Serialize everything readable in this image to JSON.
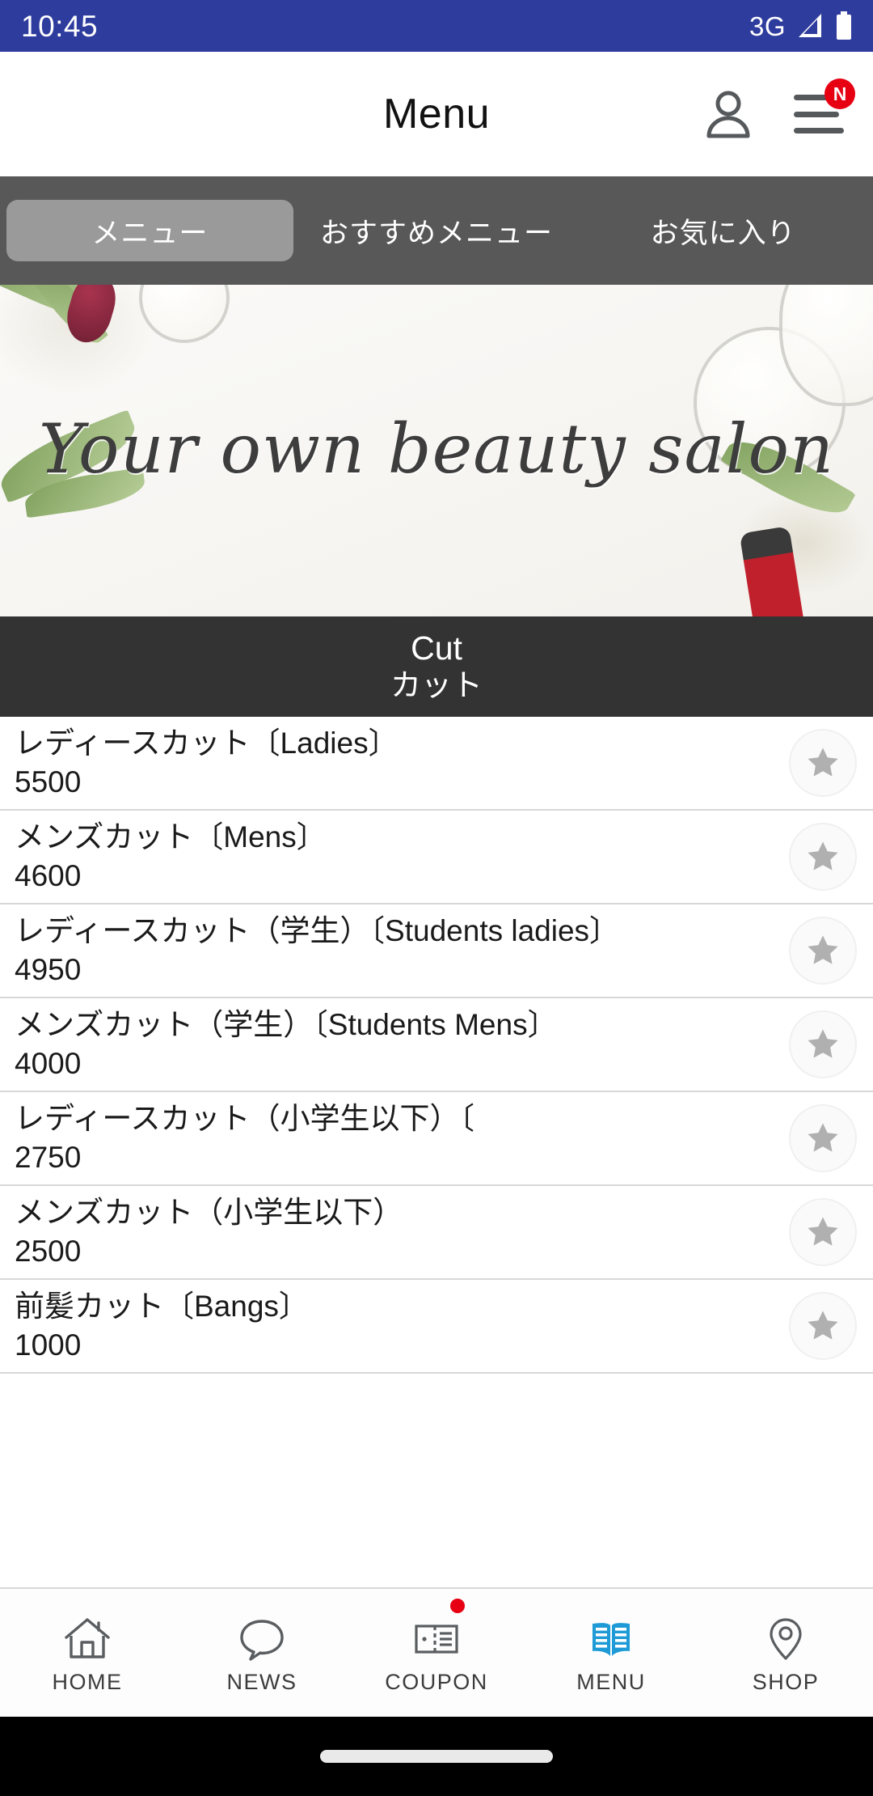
{
  "status_bar": {
    "time": "10:45",
    "network": "3G",
    "signal_icon": "signal-triangle-icon",
    "battery_icon": "battery-full-icon",
    "background_color": "#2e3c9e"
  },
  "header": {
    "title": "Menu",
    "account_icon": "person-icon",
    "menu_icon": "hamburger-menu-icon",
    "badge_label": "N",
    "badge_color": "#e60012"
  },
  "tabs": [
    {
      "label": "メニュー",
      "active": true
    },
    {
      "label": "おすすめメニュー",
      "active": false
    },
    {
      "label": "お気に入り",
      "active": false
    }
  ],
  "banner": {
    "headline": "Your own beauty salon",
    "alt": "beauty salon flat-lay with olive branches, cream jars and nail polish"
  },
  "section": {
    "title_en": "Cut",
    "title_jp": "カット",
    "background_color": "#333333"
  },
  "menu_items": [
    {
      "name": "レディースカット〔Ladies〕",
      "price": "5500",
      "favorite_icon": "star-icon"
    },
    {
      "name": "メンズカット〔Mens〕",
      "price": "4600",
      "favorite_icon": "star-icon"
    },
    {
      "name": "レディースカット（学生）〔Students ladies〕",
      "price": "4950",
      "favorite_icon": "star-icon"
    },
    {
      "name": "メンズカット（学生）〔Students Mens〕",
      "price": "4000",
      "favorite_icon": "star-icon"
    },
    {
      "name": "レディースカット（小学生以下）〔",
      "price": "2750",
      "favorite_icon": "star-icon"
    },
    {
      "name": "メンズカット（小学生以下）",
      "price": "2500",
      "favorite_icon": "star-icon"
    },
    {
      "name": "前髪カット〔Bangs〕",
      "price": "1000",
      "favorite_icon": "star-icon"
    }
  ],
  "bottom_nav": {
    "active_color": "#1e9ad6",
    "items": [
      {
        "label": "HOME",
        "icon": "home-icon",
        "active": false,
        "badge": false
      },
      {
        "label": "NEWS",
        "icon": "chat-bubble-icon",
        "active": false,
        "badge": false
      },
      {
        "label": "COUPON",
        "icon": "coupon-ticket-icon",
        "active": false,
        "badge": true
      },
      {
        "label": "MENU",
        "icon": "open-book-icon",
        "active": true,
        "badge": false
      },
      {
        "label": "SHOP",
        "icon": "location-pin-icon",
        "active": false,
        "badge": false
      }
    ]
  },
  "gesture_bar": {
    "handle": "home-gesture-handle"
  }
}
